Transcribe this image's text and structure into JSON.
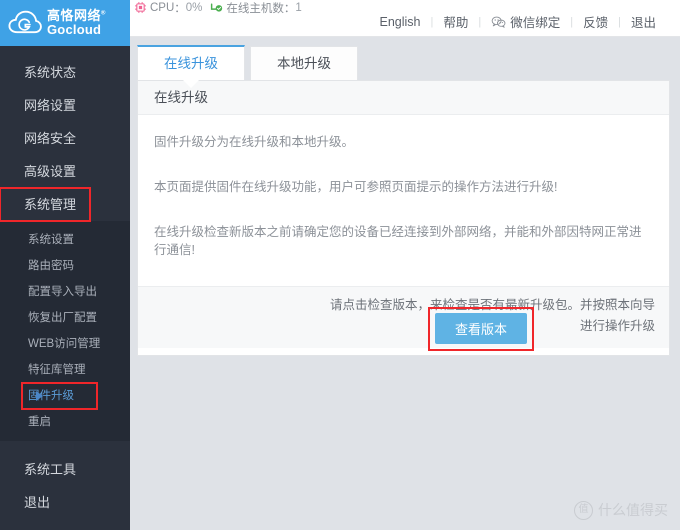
{
  "brand": {
    "cn_name": "高恪网络",
    "en_name": "Gocloud",
    "registered_mark": "®",
    "accent_color": "#3fa2e6"
  },
  "topbar": {
    "stats": [
      {
        "icon": "cpu-icon",
        "label": "CPU",
        "separator": "：",
        "value": "0%"
      },
      {
        "icon": "online-host-icon",
        "label": "在线主机数",
        "separator": "：",
        "value": "1"
      }
    ],
    "links": [
      {
        "label": "English",
        "icon": null
      },
      {
        "label": "帮助",
        "icon": null
      },
      {
        "label": "微信绑定",
        "icon": "wechat-icon"
      },
      {
        "label": "反馈",
        "icon": null
      },
      {
        "label": "退出",
        "icon": null
      }
    ],
    "separator": "|"
  },
  "sidebar": {
    "main_items": [
      {
        "label": "系统状态",
        "active": false,
        "highlighted": false
      },
      {
        "label": "网络设置",
        "active": false,
        "highlighted": false
      },
      {
        "label": "网络安全",
        "active": false,
        "highlighted": false
      },
      {
        "label": "高级设置",
        "active": false,
        "highlighted": false
      },
      {
        "label": "系统管理",
        "active": true,
        "highlighted": true
      }
    ],
    "sub_items": [
      {
        "label": "系统设置",
        "active": false,
        "highlighted": false
      },
      {
        "label": "路由密码",
        "active": false,
        "highlighted": false
      },
      {
        "label": "配置导入导出",
        "active": false,
        "highlighted": false
      },
      {
        "label": "恢复出厂配置",
        "active": false,
        "highlighted": false
      },
      {
        "label": "WEB访问管理",
        "active": false,
        "highlighted": false
      },
      {
        "label": "特征库管理",
        "active": false,
        "highlighted": false
      },
      {
        "label": "固件升级",
        "active": true,
        "highlighted": true
      },
      {
        "label": "重启",
        "active": false,
        "highlighted": false
      }
    ],
    "bottom_items": [
      {
        "label": "系统工具"
      },
      {
        "label": "退出"
      }
    ],
    "highlight_color": "#f0262a"
  },
  "main": {
    "tabs": [
      {
        "label": "在线升级",
        "active": true
      },
      {
        "label": "本地升级",
        "active": false
      }
    ],
    "panel_title": "在线升级",
    "paragraphs": [
      "固件升级分为在线升级和本地升级。",
      "本页面提供固件在线升级功能，用户可参照页面提示的操作方法进行升级!",
      "在线升级检查新版本之前请确定您的设备已经连接到外部网络，并能和外部因特网正常进行通信!"
    ],
    "footer_text": "请点击检查版本，来检查是否有最新升级包。并按照本向导进行操作升级",
    "primary_button": "查看版本",
    "primary_button_color": "#5fb3e4"
  },
  "watermark": {
    "badge": "值",
    "text": "什么值得买"
  }
}
